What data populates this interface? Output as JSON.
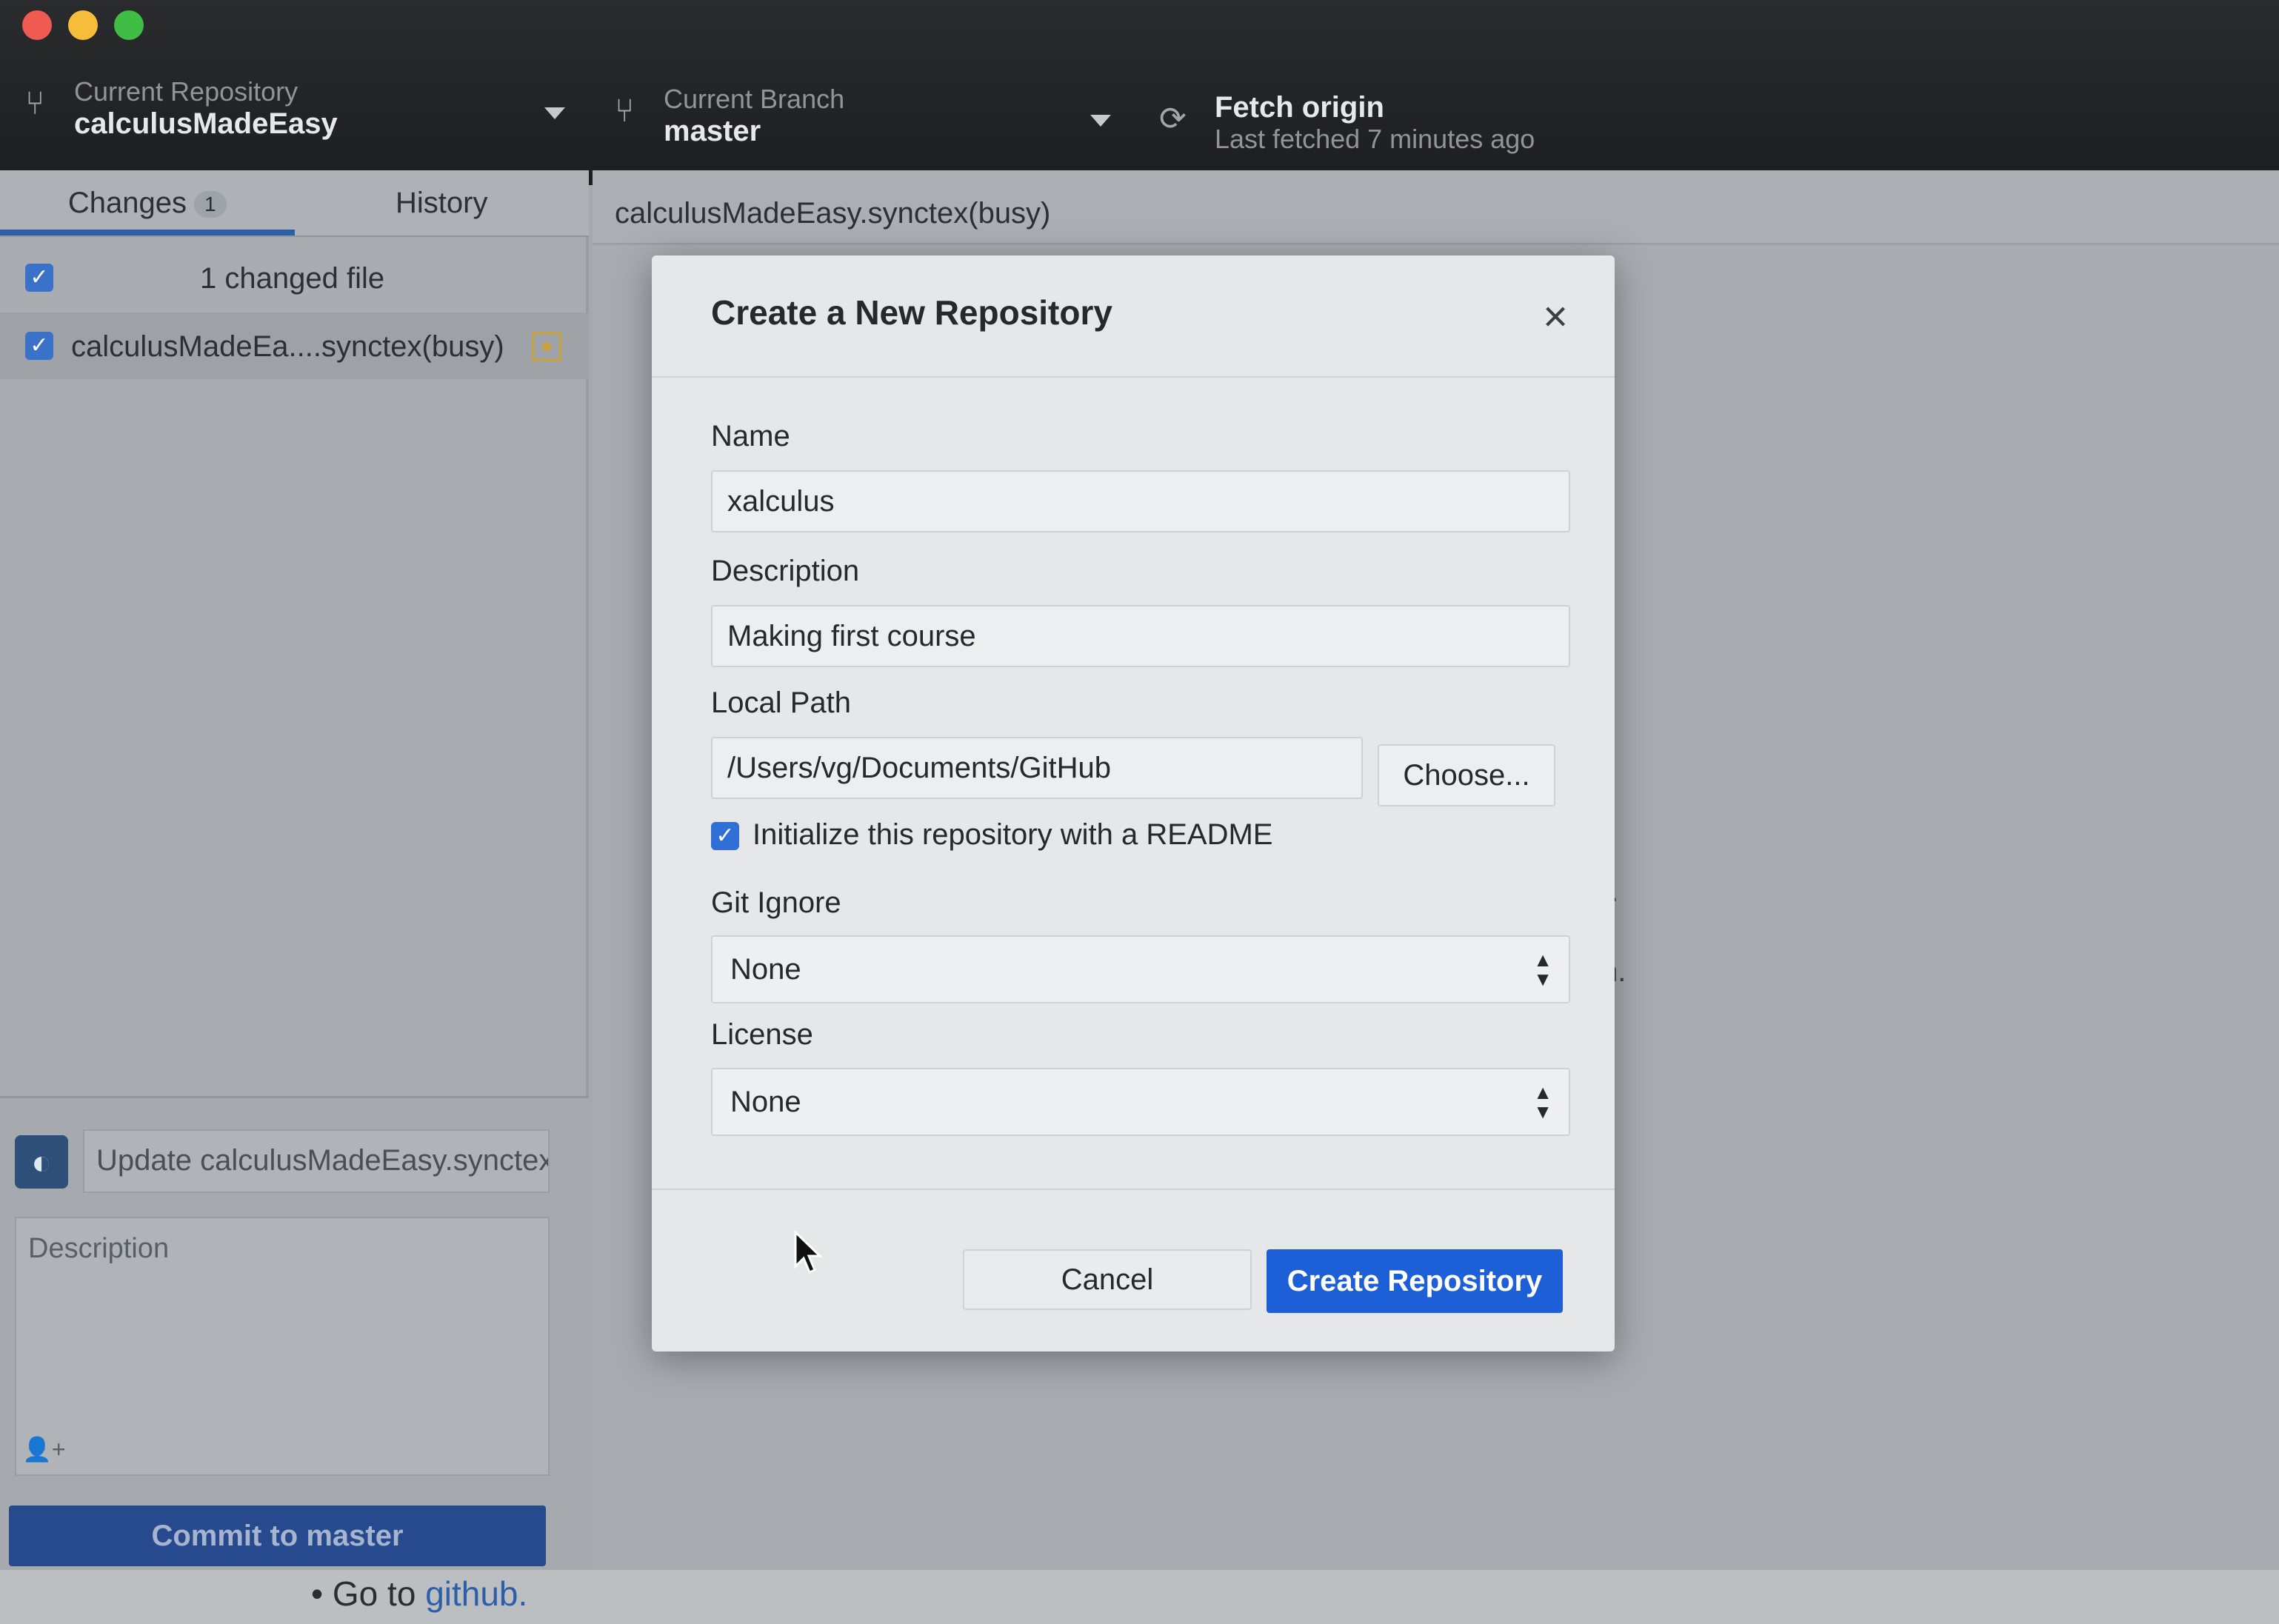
{
  "toolbar": {
    "repo_label": "Current Repository",
    "repo_name": "calculusMadeEasy",
    "branch_label": "Current Branch",
    "branch_name": "master",
    "fetch_title": "Fetch origin",
    "fetch_subtitle": "Last fetched 7 minutes ago"
  },
  "sidebar": {
    "tabs": [
      {
        "label": "Changes",
        "count": "1"
      },
      {
        "label": "History"
      }
    ],
    "changed_summary": "1 changed file",
    "files": [
      {
        "name": "calculusMadeEa....synctex(busy)",
        "status": "modified"
      }
    ],
    "commit": {
      "summary_value": "Update calculusMadeEasy.synctex(busy)",
      "description_placeholder": "Description",
      "button_label": "Commit to master"
    }
  },
  "main": {
    "diff_title": "calculusMadeEasy.synctex(busy)",
    "bg_fragment_1": "l.",
    "bg_fragment_2": "n."
  },
  "page_bottom": {
    "bullet_prefix": "Go to ",
    "bullet_link": "github."
  },
  "modal": {
    "title": "Create a New Repository",
    "name_label": "Name",
    "name_value": "xalculus",
    "description_label": "Description",
    "description_value": "Making first course",
    "local_path_label": "Local Path",
    "local_path_value": "/Users/vg/Documents/GitHub",
    "choose_label": "Choose...",
    "readme_label": "Initialize this repository with a README",
    "readme_checked": true,
    "gitignore_label": "Git Ignore",
    "gitignore_value": "None",
    "license_label": "License",
    "license_value": "None",
    "cancel_label": "Cancel",
    "create_label": "Create Repository"
  },
  "colors": {
    "accent_blue": "#1d5fd6",
    "toolbar_bg": "#1d1e20",
    "commit_button": "#274a8f"
  }
}
